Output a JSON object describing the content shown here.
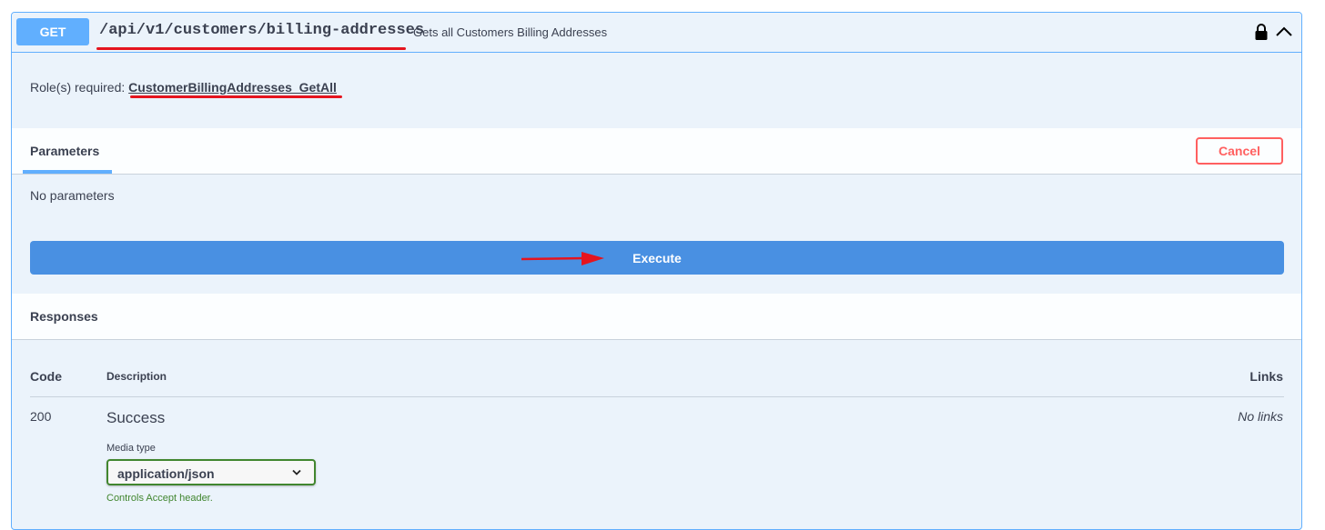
{
  "summary": {
    "method": "GET",
    "path": "/api/v1/customers/billing-addresses",
    "description": "Gets all Customers Billing Addresses",
    "lock_icon": "lock-icon",
    "collapse_icon": "chevron-up-icon"
  },
  "roles": {
    "label": "Role(s) required:",
    "name": "CustomerBillingAddresses_GetAll"
  },
  "parameters": {
    "tab_label": "Parameters",
    "cancel_label": "Cancel",
    "empty_text": "No parameters"
  },
  "execute": {
    "label": "Execute"
  },
  "responses": {
    "title": "Responses",
    "columns": {
      "code": "Code",
      "description": "Description",
      "links": "Links"
    },
    "rows": [
      {
        "code": "200",
        "description": "Success",
        "links": "No links",
        "media_type_label": "Media type",
        "media_type_value": "application/json",
        "media_type_hint": "Controls Accept header."
      }
    ]
  },
  "colors": {
    "get": "#61affe",
    "execute": "#4990e2",
    "cancel": "#ff6060",
    "annotation": "#e5141e",
    "media_border": "#41862f"
  }
}
